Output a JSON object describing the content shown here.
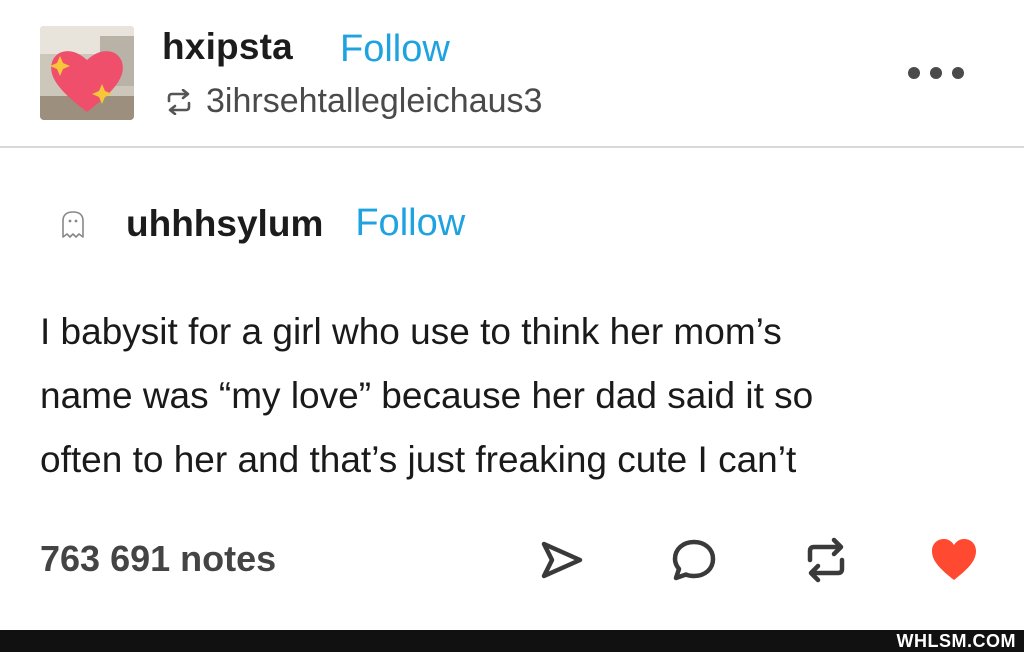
{
  "header": {
    "blog_name": "hxipsta",
    "follow_label": "Follow",
    "reblogged_from": "3ihrsehtallegleichaus3"
  },
  "original_post": {
    "author": "uhhhsylum",
    "follow_label": "Follow",
    "body_lines": [
      "I babysit for a girl who use to think her mom’s",
      "name was “my love” because her dad said it so",
      "often to her and that’s just freaking cute I can’t"
    ]
  },
  "footer": {
    "notes": "763 691 notes",
    "icons": [
      "share-icon",
      "reply-icon",
      "reblog-icon",
      "like-heart-icon"
    ]
  },
  "colors": {
    "follow_link": "#1fa3e0",
    "like_heart": "#ff4930",
    "divider": "#d8d8d8"
  },
  "watermark": "WHLSM.COM"
}
